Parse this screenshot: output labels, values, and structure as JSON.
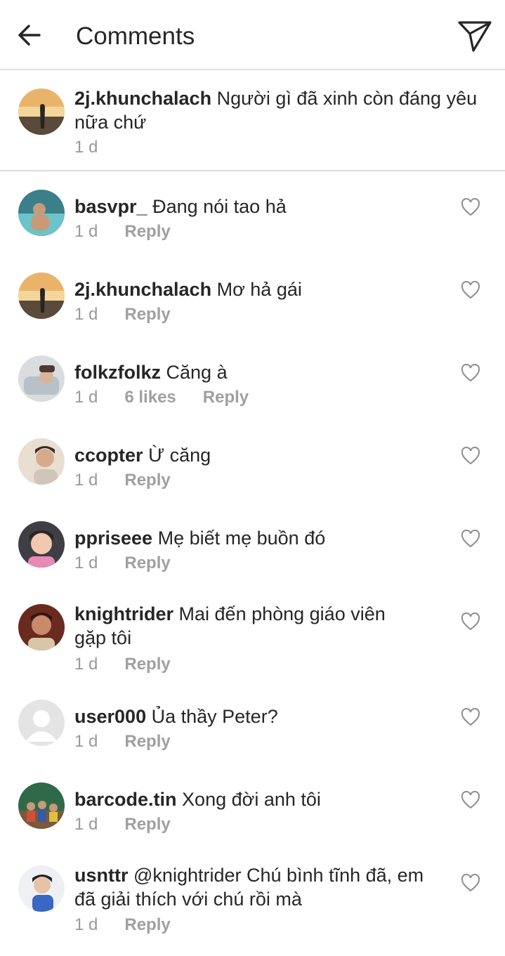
{
  "header": {
    "title": "Comments",
    "back_icon": "arrow-left-icon",
    "send_icon": "paper-plane-icon"
  },
  "caption": {
    "username": "2j.khunchalach",
    "text": "Người gì đã xinh còn đáng yêu",
    "text2": "nữa chứ",
    "time": "1 d"
  },
  "comments": [
    {
      "username": "basvpr_",
      "text": "Đang nói tao hả",
      "time": "1 d",
      "reply": "Reply"
    },
    {
      "username": "2j.khunchalach",
      "text": "Mơ hả gái",
      "time": "1 d",
      "reply": "Reply"
    },
    {
      "username": "folkzfolkz",
      "text": "Căng à",
      "time": "1 d",
      "likes": "6 likes",
      "reply": "Reply"
    },
    {
      "username": "ccopter",
      "text": "Ừ căng",
      "time": "1 d",
      "reply": "Reply"
    },
    {
      "username": "ppriseee",
      "text": "Mẹ biết mẹ buồn đó",
      "time": "1 d",
      "reply": "Reply"
    },
    {
      "username": "knightrider",
      "text": "Mai đến phòng giáo viên",
      "text2": "gặp tôi",
      "time": "1 d",
      "reply": "Reply"
    },
    {
      "username": "user000",
      "text": "Ủa thầy Peter?",
      "time": "1 d",
      "reply": "Reply"
    },
    {
      "username": "barcode.tin",
      "text": "Xong đời anh tôi",
      "time": "1 d",
      "reply": "Reply"
    },
    {
      "username": "usnttr",
      "text": "@knightrider Chú bình tĩnh đã, em",
      "text2": "đã giải thích với chú rồi mà",
      "time": "1 d",
      "reply": "Reply"
    }
  ]
}
